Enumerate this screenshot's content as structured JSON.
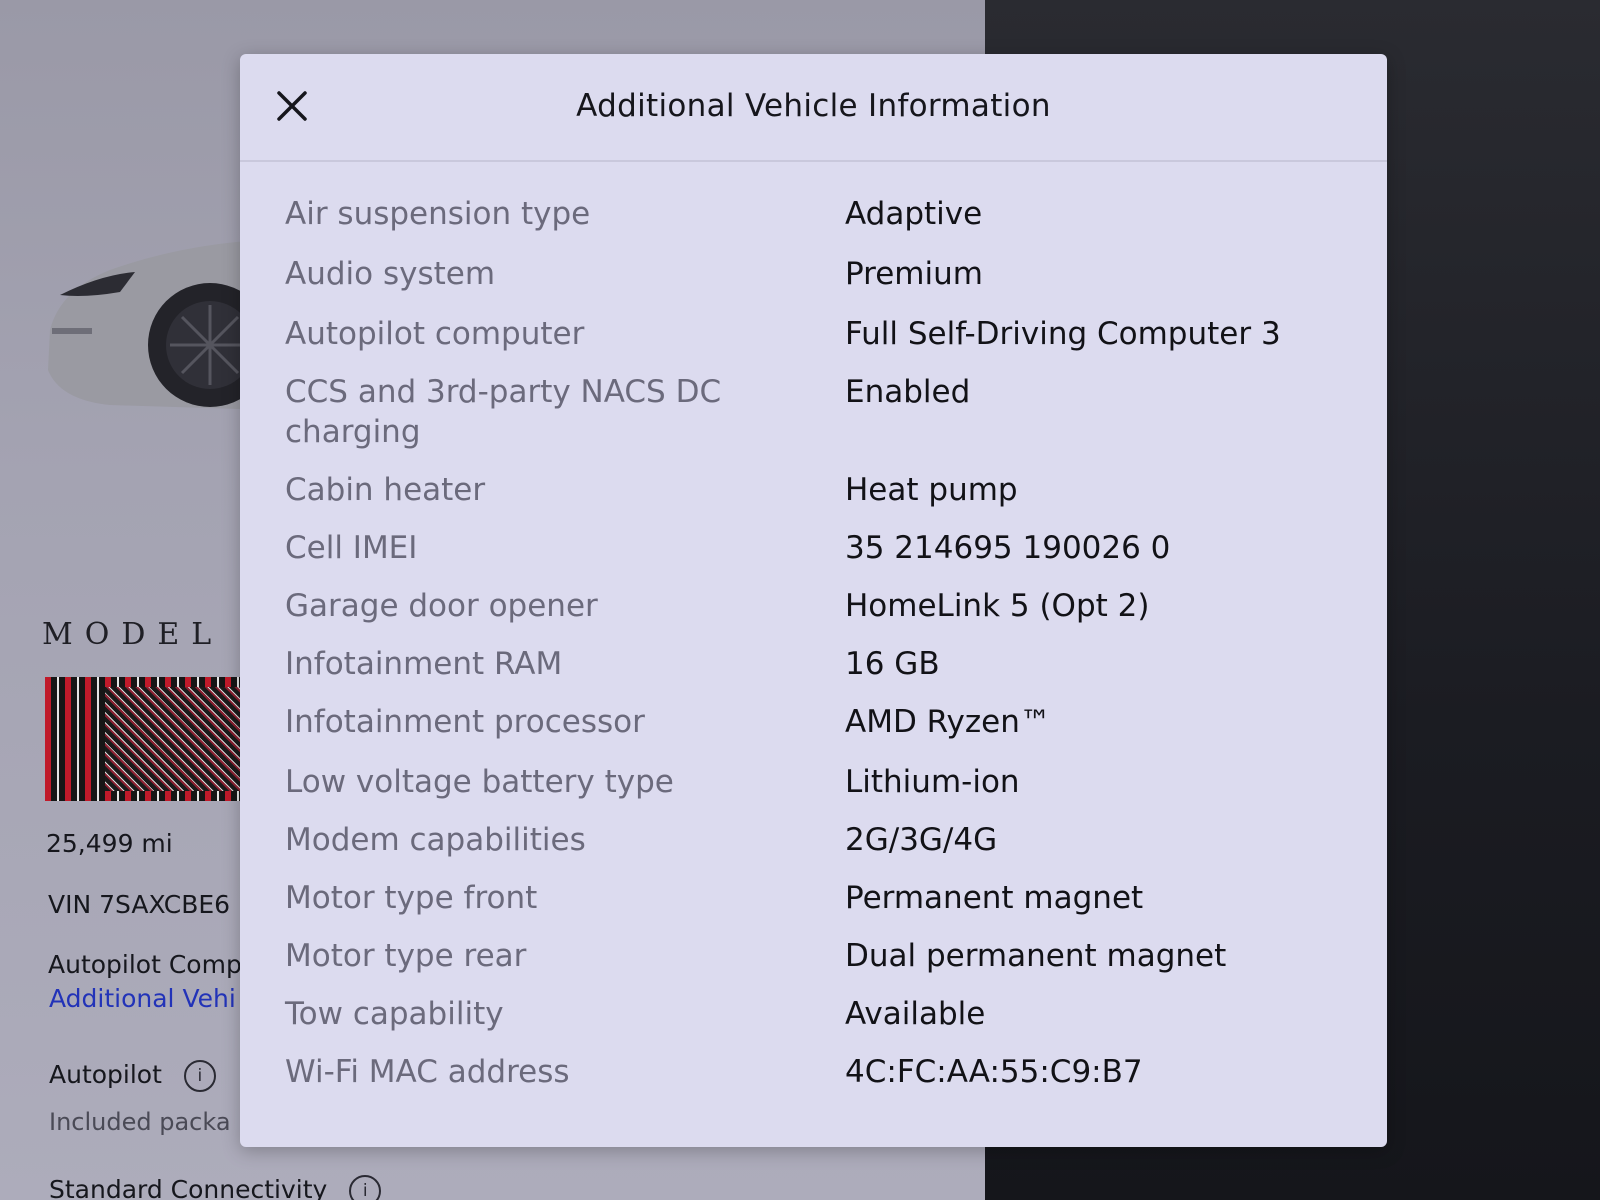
{
  "background": {
    "model_logo": "MODEL",
    "odometer": "25,499  mi",
    "vin": "VIN 7SAXCBE6",
    "autopilot_computer_partial": "Autopilot Comp",
    "additional_info_link_partial": "Additional Vehi",
    "autopilot_label": "Autopilot",
    "included_package_partial": "Included packa",
    "standard_connectivity": "Standard Connectivity"
  },
  "modal": {
    "title": "Additional Vehicle Information",
    "close_icon": "close-icon",
    "rows": [
      {
        "label": "Air suspension type",
        "value": "Adaptive"
      },
      {
        "label": "Audio system",
        "value": "Premium"
      },
      {
        "label": "Autopilot computer",
        "value": "Full Self-Driving Computer 3"
      },
      {
        "label": "CCS and 3rd-party NACS DC charging",
        "value": "Enabled"
      },
      {
        "label": "Cabin heater",
        "value": "Heat pump"
      },
      {
        "label": "Cell IMEI",
        "value": "35 214695 190026 0"
      },
      {
        "label": "Garage door opener",
        "value": "HomeLink 5 (Opt 2)"
      },
      {
        "label": "Infotainment RAM",
        "value": "16 GB"
      },
      {
        "label": "Infotainment processor",
        "value": "AMD Ryzen™"
      },
      {
        "label": "Low voltage battery type",
        "value": "Lithium-ion"
      },
      {
        "label": "Modem capabilities",
        "value": "2G/3G/4G"
      },
      {
        "label": "Motor type front",
        "value": "Permanent magnet"
      },
      {
        "label": "Motor type rear",
        "value": "Dual permanent magnet"
      },
      {
        "label": "Tow capability",
        "value": "Available"
      },
      {
        "label": "Wi-Fi MAC address",
        "value": "4C:FC:AA:55:C9:B7"
      }
    ]
  }
}
